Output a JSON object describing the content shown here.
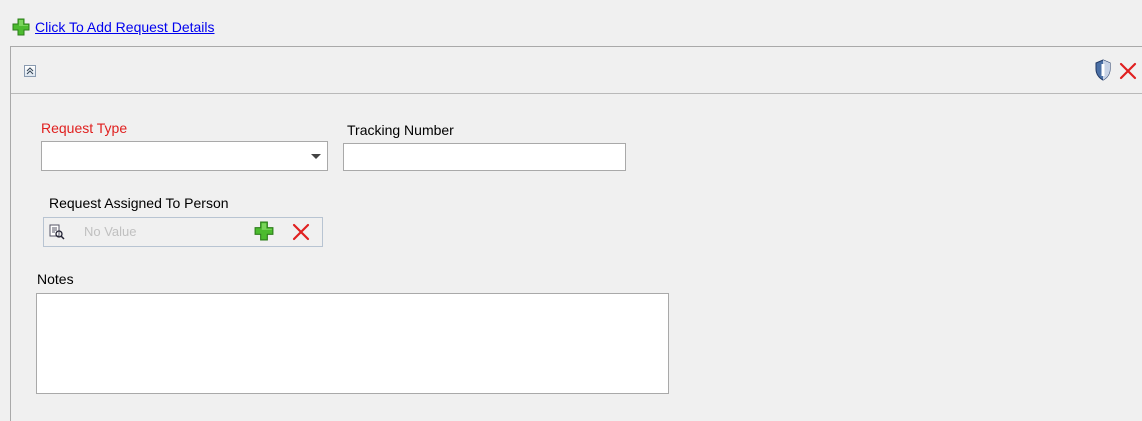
{
  "header": {
    "add_link_label": "Click To Add Request Details",
    "add_icon": "plus-icon"
  },
  "panel": {
    "collapse_icon": "collapse-up-icon",
    "shield_icon": "shield-icon",
    "close_icon": "close-icon"
  },
  "form": {
    "request_type": {
      "label": "Request Type",
      "value": "",
      "required": true
    },
    "tracking_number": {
      "label": "Tracking Number",
      "value": ""
    },
    "assigned_person": {
      "label": "Request Assigned To Person",
      "placeholder": "No Value",
      "lookup_icon": "lookup-icon",
      "add_icon": "plus-icon",
      "clear_icon": "close-icon"
    },
    "notes": {
      "label": "Notes",
      "value": ""
    }
  },
  "colors": {
    "link": "#0000ee",
    "required": "#e0201f",
    "icon_green": "#3fae2a",
    "icon_red": "#e02020",
    "background": "#f0f0f0"
  }
}
